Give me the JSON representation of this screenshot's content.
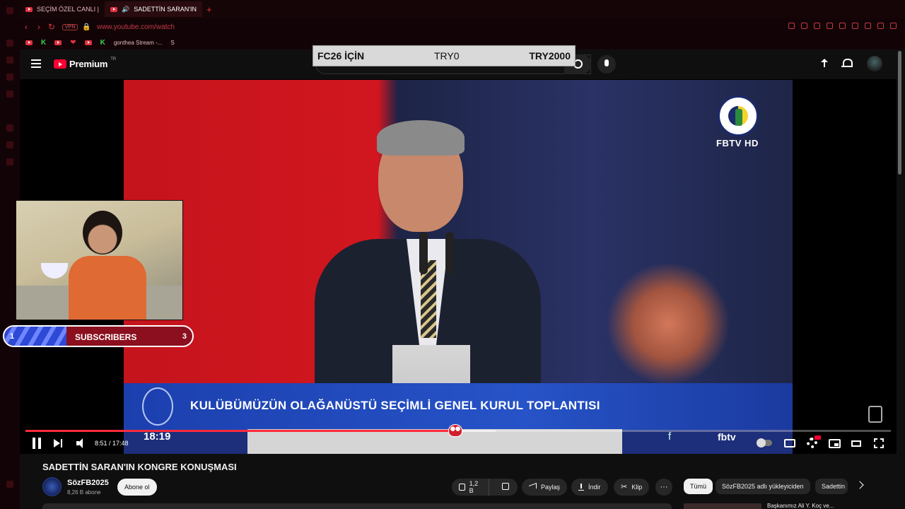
{
  "browser": {
    "tabs": [
      {
        "label": "SEÇİM ÖZEL CANLI |",
        "active": false
      },
      {
        "label": "SADETTİN SARAN'IN",
        "active": true
      }
    ],
    "new_tab": "+",
    "vpn_badge": "VPN",
    "url": "www.youtube.com/watch",
    "bookmarks": [
      {
        "label": "K"
      },
      {
        "label": "K"
      },
      {
        "label": "gonthea Stream -..."
      },
      {
        "label": "S"
      }
    ],
    "accent": "#e03140"
  },
  "masthead": {
    "logo_text": "Premium",
    "logo_region": "TR",
    "brand_red": "#ff0033"
  },
  "overlay_banner": {
    "left": "FC26 İÇİN",
    "middle": "TRY0",
    "right": "TRY2000"
  },
  "video": {
    "broadcaster": "FBTV HD",
    "lower_third": "KULÜBÜMÜZÜN OLAĞANÜSTÜ SEÇİMLİ GENEL KURUL TOPLANTISI",
    "clock": "18:19",
    "footer_brand": "fbtv",
    "footer_f": "f"
  },
  "subscriber_goal": {
    "min": "1",
    "label": "SUBSCRIBERS",
    "max": "3",
    "current_fraction": 0.33
  },
  "player": {
    "time": "8:51 / 17:48",
    "progress_fraction": 0.497,
    "buffered_fraction": 0.543
  },
  "watch": {
    "title": "SADETTİN SARAN'IN KONGRE KONUŞMASI",
    "channel": "SözFB2025",
    "subscribers": "8,26 B abone",
    "subscribe_label": "Abone ol",
    "likes": "1,2 B",
    "share": "Paylaş",
    "download": "İndir",
    "clip": "Klip",
    "more": "···",
    "chips": [
      "Tümü",
      "SözFB2025 adlı yükleyiciden",
      "Sadettin"
    ],
    "next_video_title": "Başkanımız Ali Y. Koç ve..."
  }
}
